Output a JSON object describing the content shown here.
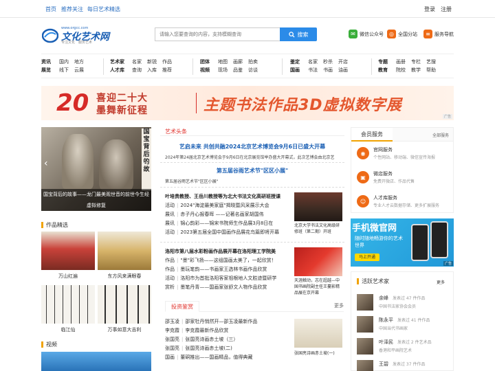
{
  "topbar": {
    "links": [
      "首页",
      "推荐关注",
      "每日艺术精选"
    ],
    "login": "登录",
    "register": "注册"
  },
  "logo": {
    "url": "www.orgcc.com",
    "name": "文化艺术网",
    "slogan": "专注文化　服务艺术"
  },
  "search": {
    "placeholder": "请输入您要查询的内容，支持模糊查询",
    "button": "搜索"
  },
  "header_services": [
    {
      "label": "微信公众号",
      "icon": "wechat-icon",
      "color": "#3aae3a"
    },
    {
      "label": "全国分站",
      "icon": "map-icon",
      "color": "#ee6a16"
    },
    {
      "label": "服务导航",
      "icon": "menu-icon",
      "color": "#ee6a16"
    }
  ],
  "nav": [
    {
      "heads": [
        "资讯",
        "展览"
      ],
      "items": [
        [
          "国内",
          "地方"
        ],
        [
          "线下",
          "云展"
        ]
      ]
    },
    {
      "heads": [
        "艺术家",
        "人才库"
      ],
      "items": [
        [
          "名家",
          "新锐",
          "作品"
        ],
        [
          "查询",
          "入库",
          "推荐"
        ]
      ]
    },
    {
      "heads": [
        "团体",
        "视频"
      ],
      "items": [
        [
          "地图",
          "画廊",
          "拍卖"
        ],
        [
          "现场",
          "品鉴",
          "访谈"
        ]
      ]
    },
    {
      "heads": [
        "鉴定",
        "国画"
      ],
      "items": [
        [
          "名家",
          "秒杀",
          "开店"
        ],
        [
          "书法",
          "书画",
          "油画"
        ]
      ]
    },
    {
      "heads": [
        "专题",
        "教育"
      ],
      "items": [
        [
          "画册",
          "专栏",
          "艺搜"
        ],
        [
          "院校",
          "教学",
          "帮助"
        ]
      ]
    }
  ],
  "banner": {
    "num": "20",
    "t1": "喜迎二十大",
    "t2": "墨舞新征程",
    "main": "主题书法作品3D虚拟数字展",
    "ad": "广告"
  },
  "slider": {
    "calligraphy": "国宝背后的故",
    "caption": "国宝背后的故事——龙门最美观世音的前世今生经",
    "caption2": "虚拟修复"
  },
  "works_section": {
    "title": "作品精选",
    "items": [
      "万山红遍",
      "东方风来满眼春",
      "临江仙",
      "万事如意大吉利"
    ]
  },
  "video_section": {
    "title": "视频"
  },
  "headlines": {
    "title": "艺术头条",
    "lead1": "艺启未来 共创共融2024北京艺术博览会9月6日已盛大开幕",
    "lead1_sub": "2024年第24届北京艺术博览会于9月6日在北京展览馆举办盛大开幕式，此次艺博会由北京艺",
    "lead2": "第五届谷雨艺术节\"区区小展\"",
    "lead2_sub": "第五届谷雨艺术节\"区区小展\""
  },
  "news_block1": {
    "head": "叶培贵教授、王岳川教授等为北大书法文化高研班授课",
    "items": [
      [
        "活动",
        "2024\"海淀最美家庭\"揭晓暨风采展示大会"
      ],
      [
        "展讯",
        "赤子丹心报春晖 ——记著名画家胡国伟"
      ],
      [
        "展讯",
        "锦心韵彩——锦宋书院师生作品展3月8日在"
      ],
      [
        "活动",
        "2023第五届全国中国画作品展花鸟篇即将开幕"
      ]
    ],
    "pic_caption": "北京大学书法文化高级研修班（第二期）开班"
  },
  "news_block2": {
    "head": "洛阳市第八届水彩粉画作品展开幕在洛阳理工学院美",
    "items": [
      [
        "作品",
        "\"墨\"彩飞扬——这组国画太美了，一起欣赏！"
      ],
      [
        "作品",
        "墨玩笔韵——书画家王选林书画作品欣赏"
      ],
      [
        "活动",
        "洛阳市为首批洛阳客家祖根地人文胜迹暨研学"
      ],
      [
        "赏析",
        "墨笔丹青——国画家张舒文人物作品欣赏"
      ]
    ],
    "pic_caption": "天涯触动，志在超越—中国书画院副主任王蔓影精品展在京开幕"
  },
  "invest": {
    "tab": "投资鉴赏",
    "more": "更多",
    "items": [
      [
        "邵玉凌",
        "邵家牡丹悄然开—邵玉凌最新作品"
      ],
      [
        "李克霞",
        "李克霞最新作品欣赏"
      ],
      [
        "张国亮",
        "张国亮诗画赤土坡（三）"
      ],
      [
        "张国亮",
        "张国亮诗画赤土坡(二)"
      ],
      [
        "国画",
        "董硐推出——国画精品，值得典藏"
      ]
    ],
    "pic_caption": "张国亮诗画赤土坡(一)"
  },
  "member": {
    "title": "会员服务",
    "more": "全部服务",
    "services": [
      {
        "title": "官网服务",
        "desc": "个性网站、移动端、微信宣传海报"
      },
      {
        "title": "微店服务",
        "desc": "免费开微店、作品代售"
      },
      {
        "title": "人才库服务",
        "desc": "专业人才云数据存储、更多扩展服务"
      }
    ]
  },
  "wechat_ad": {
    "t1": "手机微官网",
    "t2": "随时随地畅游你的艺术世界",
    "btn": "马上开通",
    "ad": "广告"
  },
  "artists": {
    "title": "活跃艺术家",
    "more": "更多",
    "items": [
      {
        "name": "余峰",
        "stat": "发表过 47 件作品",
        "desc": "中国书法家协会会员"
      },
      {
        "name": "陈永平",
        "stat": "发表过 41 件作品",
        "desc": "中国当代书画家"
      },
      {
        "name": "叶泽民",
        "stat": "发表过 2 件艺术品",
        "desc": "香港和平画院艺术"
      },
      {
        "name": "王碧",
        "stat": "发表过 37 件作品",
        "desc": ""
      }
    ]
  },
  "colors": {
    "accent": "#2b8be8",
    "brand": "#1a5fb4",
    "red": "#e0312b",
    "orange": "#ee6a16"
  }
}
